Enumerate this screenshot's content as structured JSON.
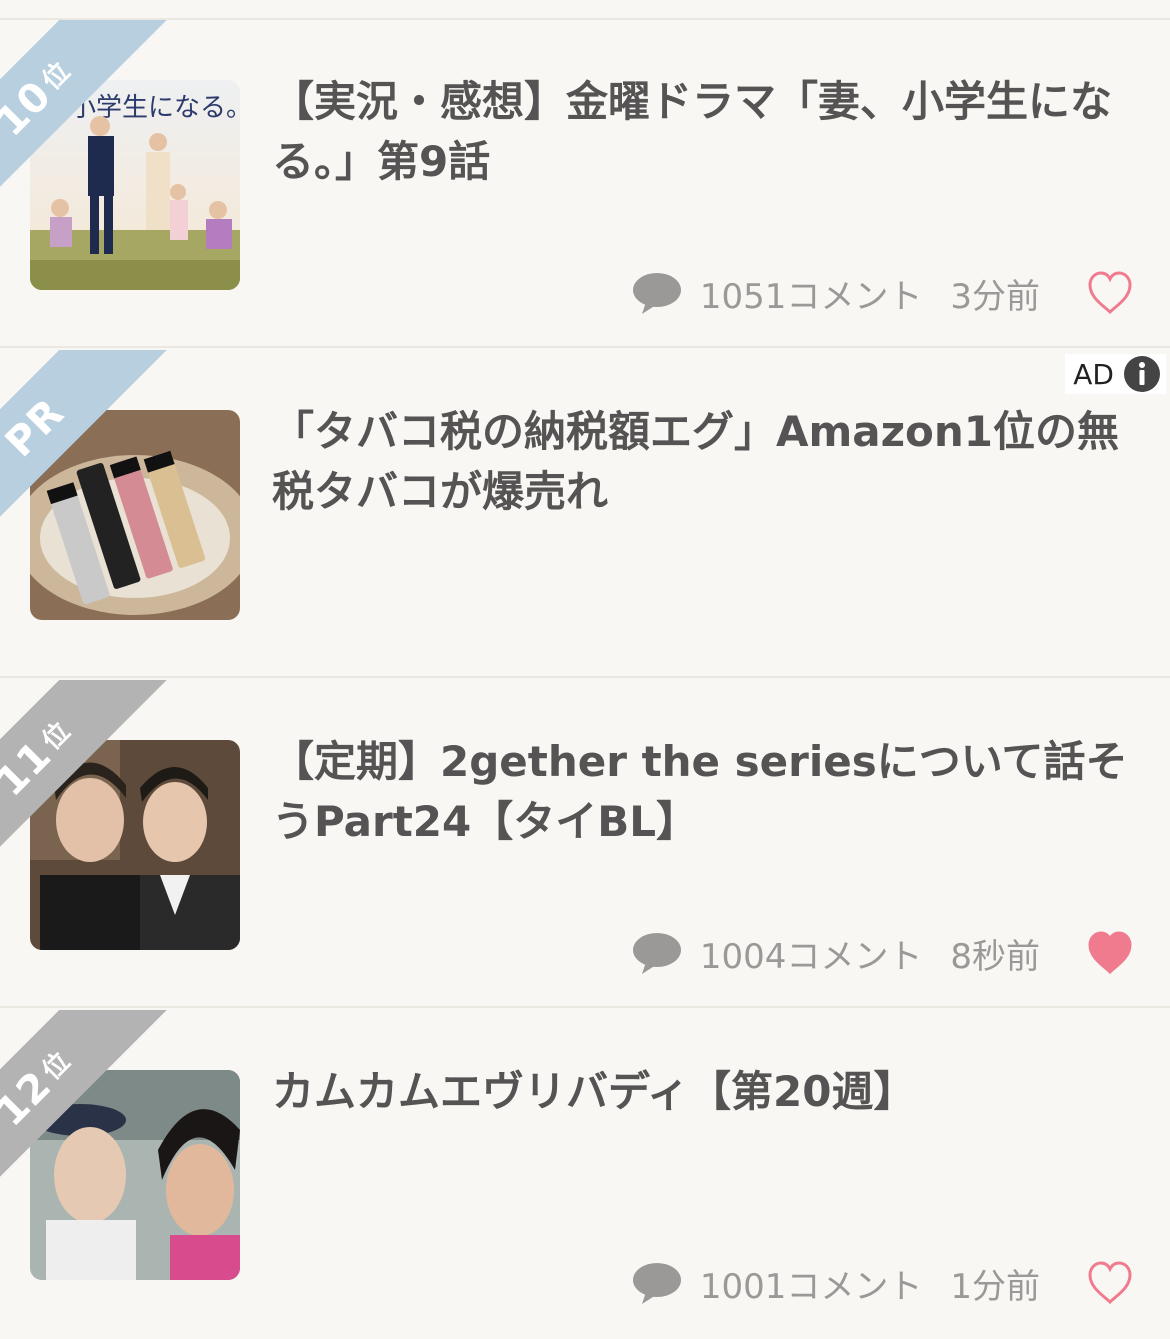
{
  "items": [
    {
      "rank": "10",
      "rank_suffix": "位",
      "title": "【実況・感想】金曜ドラマ「妻、小学生になる。」第9話",
      "comments": "1051コメント",
      "time": "3分前",
      "liked": false,
      "ribbon_color": "#b8cfe0",
      "thumb_text": "妻、小学生になる。"
    },
    {
      "rank": "PR",
      "title": "「タバコ税の納税額エグ」Amazon1位の無税タバコが爆売れ",
      "ad_label": "AD",
      "ribbon_color": "#b8cfe0"
    },
    {
      "rank": "11",
      "rank_suffix": "位",
      "title": "【定期】2gether the seriesについて話そうPart24【タイBL】",
      "comments": "1004コメント",
      "time": "8秒前",
      "liked": true,
      "ribbon_color": "#b3b3b3"
    },
    {
      "rank": "12",
      "rank_suffix": "位",
      "title": "カムカムエヴリバディ【第20週】",
      "comments": "1001コメント",
      "time": "1分前",
      "liked": false,
      "ribbon_color": "#b3b3b3"
    }
  ],
  "colors": {
    "heart": "#f07a8e",
    "text": "#555353",
    "meta": "#9b9898"
  }
}
